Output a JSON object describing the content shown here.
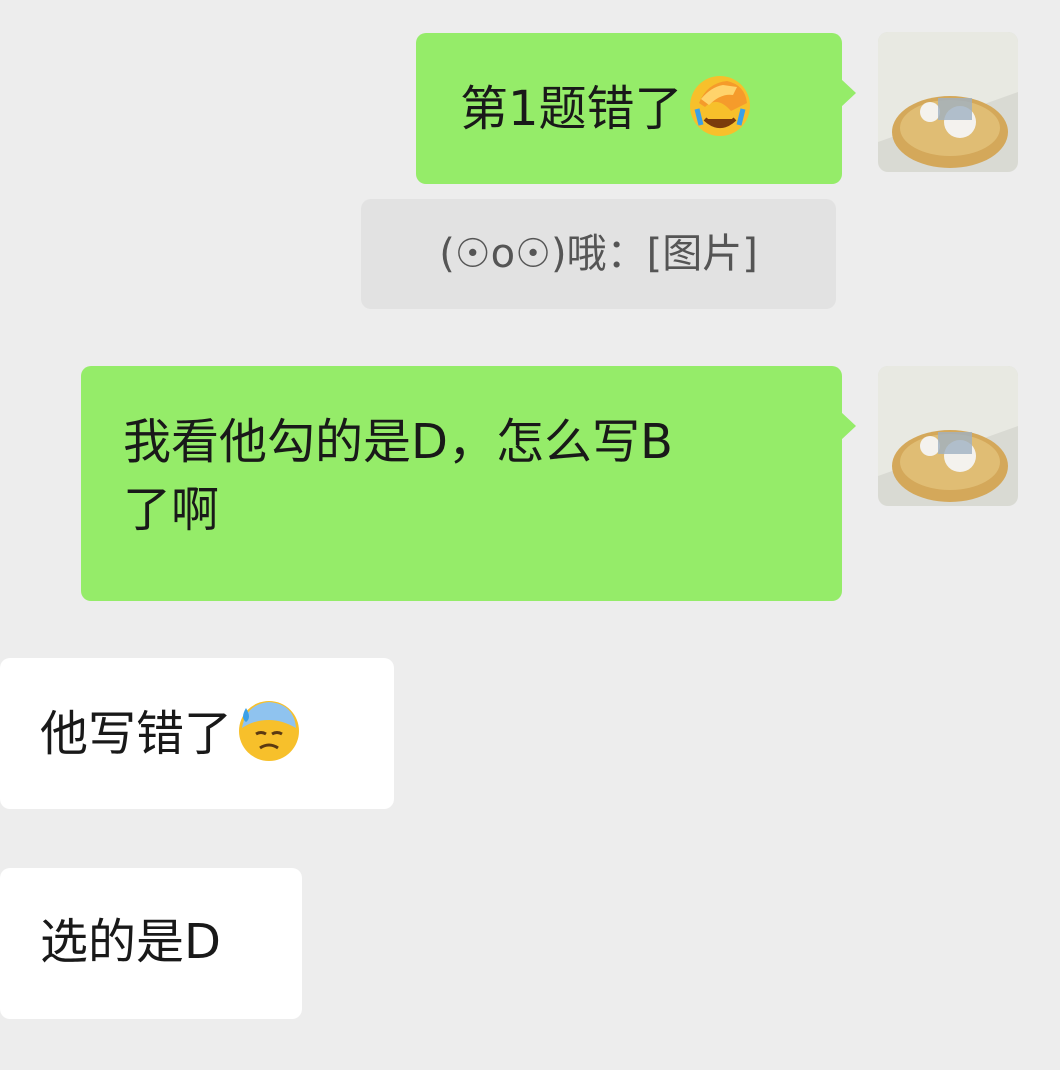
{
  "chat": {
    "messages": [
      {
        "sender": "me",
        "text": "第1题错了",
        "emoji": "face-palm-emoji"
      },
      {
        "quote": "(☉o☉)哦：[图片]"
      },
      {
        "sender": "me",
        "text_line1": "我看他勾的是D，怎么写B",
        "text_line2": "了啊"
      },
      {
        "sender": "other",
        "text": "他写错了",
        "emoji": "anxious-sweat-emoji"
      },
      {
        "sender": "other",
        "text": "选的是D"
      }
    ]
  },
  "colors": {
    "background": "#ededed",
    "my_bubble": "#95ec69",
    "other_bubble": "#ffffff",
    "quote_bg": "#e2e2e2"
  }
}
